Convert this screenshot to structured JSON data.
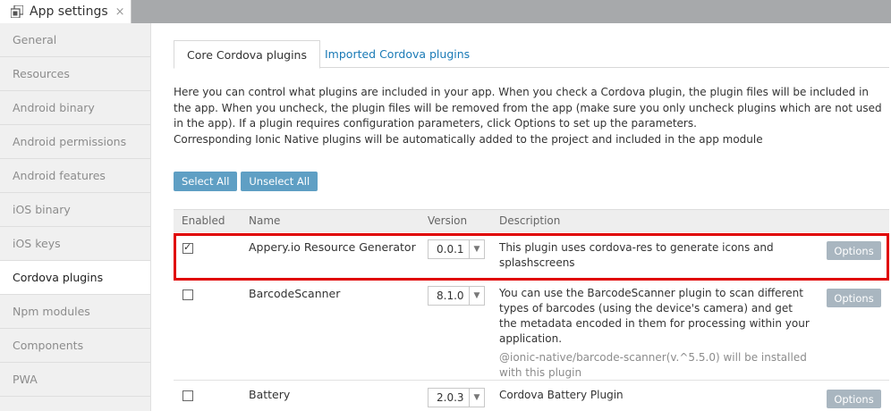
{
  "app_tab": {
    "title": "App settings",
    "close": "×"
  },
  "sidebar": {
    "items": [
      {
        "label": "General"
      },
      {
        "label": "Resources"
      },
      {
        "label": "Android binary"
      },
      {
        "label": "Android permissions"
      },
      {
        "label": "Android features"
      },
      {
        "label": "iOS binary"
      },
      {
        "label": "iOS keys"
      },
      {
        "label": "Cordova plugins",
        "active": true
      },
      {
        "label": "Npm modules"
      },
      {
        "label": "Components"
      },
      {
        "label": "PWA"
      }
    ]
  },
  "tabs": [
    {
      "label": "Core Cordova plugins",
      "active": true
    },
    {
      "label": "Imported Cordova plugins"
    }
  ],
  "intro": {
    "line1": "Here you can control what plugins are included in your app. When you check a Cordova plugin, the plugin files will be included in the app. When you uncheck, the plugin files will be removed from the app (make sure you only uncheck plugins which are not used in the app). If a plugin requires configuration parameters, click Options to set up the parameters.",
    "line2": "Corresponding Ionic Native plugins will be automatically added to the project and included in the app module"
  },
  "buttons": {
    "select_all": "Select All",
    "unselect_all": "Unselect All"
  },
  "table": {
    "headers": {
      "enabled": "Enabled",
      "name": "Name",
      "version": "Version",
      "description": "Description"
    },
    "rows": [
      {
        "checked": true,
        "name": "Appery.io Resource Generator",
        "version": "0.0.1",
        "description": "This plugin uses cordova-res to generate icons and splashscreens",
        "note": "",
        "options": "Options"
      },
      {
        "checked": false,
        "name": "BarcodeScanner",
        "version": "8.1.0",
        "description": "You can use the BarcodeScanner plugin to scan different types of barcodes (using the device's camera) and get the metadata encoded in them for processing within your application.",
        "note": "@ionic-native/barcode-scanner(v.^5.5.0) will be installed with this plugin",
        "options": "Options"
      },
      {
        "checked": false,
        "name": "Battery",
        "version": "2.0.3",
        "description": "Cordova Battery Plugin",
        "note": "",
        "options": "Options"
      }
    ]
  },
  "colors": {
    "accent": "#1a7ab6",
    "button": "#5f9fc4",
    "options_button": "#a9b6c0",
    "highlight": "#e00000"
  }
}
